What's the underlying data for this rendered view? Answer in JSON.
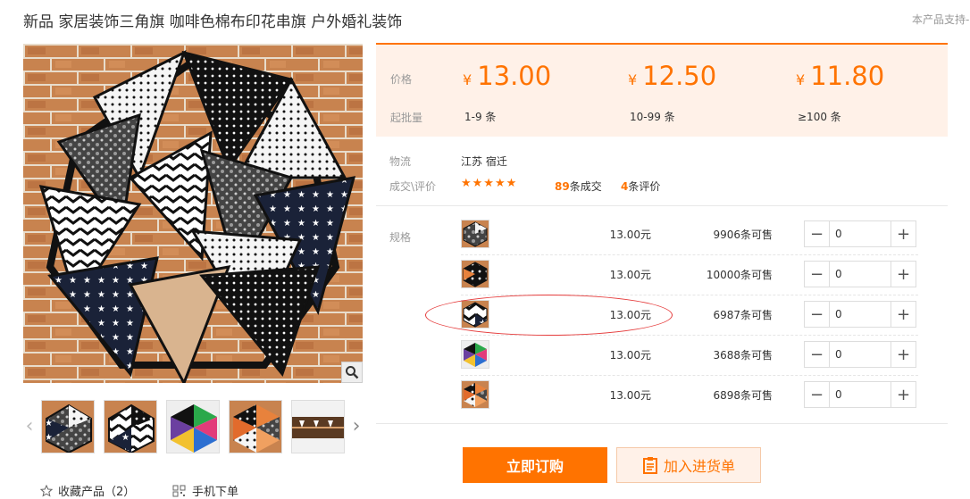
{
  "title": "新品 家居装饰三角旗 咖啡色棉布印花串旗 户外婚礼装饰",
  "support_text": "本产品支持-",
  "price_section": {
    "price_label": "价格",
    "moq_label": "起批量",
    "currency": "¥",
    "tiers": [
      {
        "price": "13.00",
        "quantity": "1-9 条"
      },
      {
        "price": "12.50",
        "quantity": "10-99 条"
      },
      {
        "price": "11.80",
        "quantity": "≥100 条"
      }
    ]
  },
  "logistics": {
    "label": "物流",
    "value": "江苏 宿迁"
  },
  "reviews": {
    "label": "成交\\评价",
    "stars": "★★★★★",
    "orders_count": "89",
    "orders_suffix": "条成交",
    "review_count": "4",
    "review_suffix": "条评价"
  },
  "spec": {
    "label": "规格",
    "rows": [
      {
        "price": "13.00元",
        "stock": "9906条可售",
        "qty": "0"
      },
      {
        "price": "13.00元",
        "stock": "10000条可售",
        "qty": "0"
      },
      {
        "price": "13.00元",
        "stock": "6987条可售",
        "qty": "0"
      },
      {
        "price": "13.00元",
        "stock": "3688条可售",
        "qty": "0"
      },
      {
        "price": "13.00元",
        "stock": "6898条可售",
        "qty": "0"
      }
    ]
  },
  "buttons": {
    "order": "立即订购",
    "add_cart": "加入进货单"
  },
  "links": {
    "favorite": "收藏产品（2）",
    "mobile": "手机下单"
  },
  "colors": {
    "accent": "#ff7300",
    "price_bg": "#fff1e8",
    "highlight": "#e53b3b"
  },
  "icons": {
    "zoom": "magnifier-icon",
    "favorite": "star-outline-icon",
    "mobile": "qr-grid-icon",
    "cart": "clipboard-icon"
  }
}
